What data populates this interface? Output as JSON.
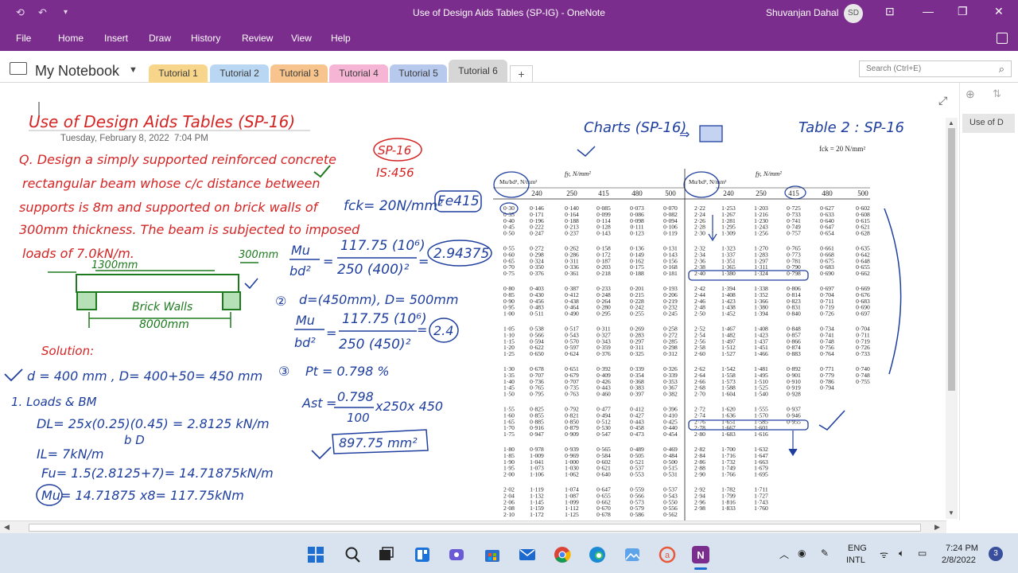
{
  "window": {
    "title": "Use of Design Aids Tables (SP-IG)  -  OneNote",
    "user_name": "Shuvanjan Dahal",
    "user_initials": "SD"
  },
  "menu": [
    "File",
    "Home",
    "Insert",
    "Draw",
    "History",
    "Review",
    "View",
    "Help"
  ],
  "notebook": {
    "name": "My Notebook",
    "tabs": [
      {
        "label": "Tutorial 1",
        "color": "#f7d58b"
      },
      {
        "label": "Tutorial 2",
        "color": "#b9d7f2"
      },
      {
        "label": "Tutorial 3",
        "color": "#f6c48c"
      },
      {
        "label": "Tutorial 4",
        "color": "#f6b5d5"
      },
      {
        "label": "Tutorial 5",
        "color": "#b8c9ee"
      },
      {
        "label": "Tutorial 6",
        "color": "#d6d6d6"
      }
    ],
    "add_tab": "+",
    "search_placeholder": "Search (Ctrl+E)"
  },
  "page_list": {
    "current": "Use of D"
  },
  "note": {
    "title": "Use of Design Aids Tables (SP-16)",
    "date": "Tuesday, February 8, 2022",
    "time": "7:04 PM",
    "question": [
      "Q. Design a simply supported reinforced concrete",
      "rectangular beam whose c/c distance between",
      "supports is 8m and supported on brick walls of",
      "300mm thickness. The beam is subjected to imposed",
      "loads of 7.0kN/m."
    ],
    "sketch": {
      "span": "1300mm",
      "support": "300mm",
      "walls": "Brick Walls",
      "length": "8000mm"
    },
    "solution_heading": "Solution:",
    "solution": [
      "d = 400 mm , D= 400+50= 450 mm",
      "1. Loads & BM",
      "DL= 25x(0.25)(0.45) = 2.8125 kN/m",
      "b        D",
      "IL= 7kN/m",
      "Fu= 1.5(2.8125+7)= 14.71875kN/m",
      "Mu= 14.71875 x8= 117.75kNm"
    ],
    "middle": {
      "sp16": "SP-16",
      "is456": "IS:456",
      "fck": "fck= 20N/mm²",
      "fe": "Fe415",
      "mu": "Mu",
      "bd2": "bd²",
      "eq1_num": "117.75 (10⁶)",
      "eq1_den": "250 (400)²",
      "eq1_res": "2.94375",
      "step2": "d=(450mm), D= 500mm",
      "eq2_num": "117.75 (10⁶)",
      "eq2_den": "250 (450)²",
      "eq2_res": "2.4",
      "step3": "Pt = 0.798 %",
      "ast": "Ast",
      "ast_num": "0.798",
      "ast_den": "100",
      "ast_tail": "x250x 450",
      "ast_res": "897.75 mm²"
    },
    "top_right": {
      "charts": "Charts (SP-16)",
      "table": "Table 2 : SP-16",
      "fck_note": "fck = 20 N/mm²"
    }
  },
  "table": {
    "fy_label": "fy, N/mm²",
    "mu_label": "Mu/bd², N/mm²",
    "fy_values": [
      "240",
      "250",
      "415",
      "480",
      "500"
    ],
    "left_groups": [
      [
        [
          "0·30",
          "0·146",
          "0·140",
          "0·085",
          "0·073",
          "0·070"
        ],
        [
          "0·35",
          "0·171",
          "0·164",
          "0·099",
          "0·086",
          "0·082"
        ],
        [
          "0·40",
          "0·196",
          "0·188",
          "0·114",
          "0·098",
          "0·094"
        ],
        [
          "0·45",
          "0·222",
          "0·213",
          "0·128",
          "0·111",
          "0·106"
        ],
        [
          "0·50",
          "0·247",
          "0·237",
          "0·143",
          "0·123",
          "0·119"
        ]
      ],
      [
        [
          "0·55",
          "0·272",
          "0·262",
          "0·158",
          "0·136",
          "0·131"
        ],
        [
          "0·60",
          "0·298",
          "0·286",
          "0·172",
          "0·149",
          "0·143"
        ],
        [
          "0·65",
          "0·324",
          "0·311",
          "0·187",
          "0·162",
          "0·156"
        ],
        [
          "0·70",
          "0·350",
          "0·336",
          "0·203",
          "0·175",
          "0·168"
        ],
        [
          "0·75",
          "0·376",
          "0·361",
          "0·218",
          "0·188",
          "0·181"
        ]
      ],
      [
        [
          "0·80",
          "0·403",
          "0·387",
          "0·233",
          "0·201",
          "0·193"
        ],
        [
          "0·85",
          "0·430",
          "0·412",
          "0·248",
          "0·215",
          "0·206"
        ],
        [
          "0·90",
          "0·456",
          "0·438",
          "0·264",
          "0·228",
          "0·219"
        ],
        [
          "0·95",
          "0·483",
          "0·464",
          "0·280",
          "0·242",
          "0·232"
        ],
        [
          "1·00",
          "0·511",
          "0·490",
          "0·295",
          "0·255",
          "0·245"
        ]
      ],
      [
        [
          "1·05",
          "0·538",
          "0·517",
          "0·311",
          "0·269",
          "0·258"
        ],
        [
          "1·10",
          "0·566",
          "0·543",
          "0·327",
          "0·283",
          "0·272"
        ],
        [
          "1·15",
          "0·594",
          "0·570",
          "0·343",
          "0·297",
          "0·285"
        ],
        [
          "1·20",
          "0·622",
          "0·597",
          "0·359",
          "0·311",
          "0·298"
        ],
        [
          "1·25",
          "0·650",
          "0·624",
          "0·376",
          "0·325",
          "0·312"
        ]
      ],
      [
        [
          "1·30",
          "0·678",
          "0·651",
          "0·392",
          "0·339",
          "0·326"
        ],
        [
          "1·35",
          "0·707",
          "0·679",
          "0·409",
          "0·354",
          "0·339"
        ],
        [
          "1·40",
          "0·736",
          "0·707",
          "0·426",
          "0·368",
          "0·353"
        ],
        [
          "1·45",
          "0·765",
          "0·735",
          "0·443",
          "0·383",
          "0·367"
        ],
        [
          "1·50",
          "0·795",
          "0·763",
          "0·460",
          "0·397",
          "0·382"
        ]
      ],
      [
        [
          "1·55",
          "0·825",
          "0·792",
          "0·477",
          "0·412",
          "0·396"
        ],
        [
          "1·60",
          "0·855",
          "0·821",
          "0·494",
          "0·427",
          "0·410"
        ],
        [
          "1·65",
          "0·885",
          "0·850",
          "0·512",
          "0·443",
          "0·425"
        ],
        [
          "1·70",
          "0·916",
          "0·879",
          "0·530",
          "0·458",
          "0·440"
        ],
        [
          "1·75",
          "0·947",
          "0·909",
          "0·547",
          "0·473",
          "0·454"
        ]
      ],
      [
        [
          "1·80",
          "0·978",
          "0·939",
          "0·565",
          "0·489",
          "0·469"
        ],
        [
          "1·85",
          "1·009",
          "0·969",
          "0·584",
          "0·505",
          "0·484"
        ],
        [
          "1·90",
          "1·041",
          "1·000",
          "0·602",
          "0·521",
          "0·500"
        ],
        [
          "1·95",
          "1·073",
          "1·030",
          "0·621",
          "0·537",
          "0·515"
        ],
        [
          "2·00",
          "1·106",
          "1·062",
          "0·640",
          "0·553",
          "0·531"
        ]
      ],
      [
        [
          "2·02",
          "1·119",
          "1·074",
          "0·647",
          "0·559",
          "0·537"
        ],
        [
          "2·04",
          "1·132",
          "1·087",
          "0·655",
          "0·566",
          "0·543"
        ],
        [
          "2·06",
          "1·145",
          "1·099",
          "0·662",
          "0·573",
          "0·550"
        ],
        [
          "2·08",
          "1·159",
          "1·112",
          "0·670",
          "0·579",
          "0·556"
        ],
        [
          "2·10",
          "1·172",
          "1·125",
          "0·678",
          "0·586",
          "0·562"
        ]
      ]
    ],
    "right_groups": [
      [
        [
          "2·22",
          "1·253",
          "1·203",
          "0·725",
          "0·627",
          "0·602"
        ],
        [
          "2·24",
          "1·267",
          "1·216",
          "0·733",
          "0·633",
          "0·608"
        ],
        [
          "2·26",
          "1·281",
          "1·230",
          "0·741",
          "0·640",
          "0·615"
        ],
        [
          "2·28",
          "1·295",
          "1·243",
          "0·749",
          "0·647",
          "0·621"
        ],
        [
          "2·30",
          "1·309",
          "1·256",
          "0·757",
          "0·654",
          "0·628"
        ]
      ],
      [
        [
          "2·32",
          "1·323",
          "1·270",
          "0·765",
          "0·661",
          "0·635"
        ],
        [
          "2·34",
          "1·337",
          "1·283",
          "0·773",
          "0·668",
          "0·642"
        ],
        [
          "2·36",
          "1·351",
          "1·297",
          "0·781",
          "0·675",
          "0·648"
        ],
        [
          "2·38",
          "1·365",
          "1·311",
          "0·790",
          "0·683",
          "0·655"
        ],
        [
          "2·40",
          "1·380",
          "1·324",
          "0·798",
          "0·690",
          "0·662"
        ]
      ],
      [
        [
          "2·42",
          "1·394",
          "1·338",
          "0·806",
          "0·697",
          "0·669"
        ],
        [
          "2·44",
          "1·408",
          "1·352",
          "0·814",
          "0·704",
          "0·676"
        ],
        [
          "2·46",
          "1·423",
          "1·366",
          "0·823",
          "0·711",
          "0·683"
        ],
        [
          "2·48",
          "1·438",
          "1·380",
          "0·831",
          "0·719",
          "0·690"
        ],
        [
          "2·50",
          "1·452",
          "1·394",
          "0·840",
          "0·726",
          "0·697"
        ]
      ],
      [
        [
          "2·52",
          "1·467",
          "1·408",
          "0·848",
          "0·734",
          "0·704"
        ],
        [
          "2·54",
          "1·482",
          "1·423",
          "0·857",
          "0·741",
          "0·711"
        ],
        [
          "2·56",
          "1·497",
          "1·437",
          "0·866",
          "0·748",
          "0·719"
        ],
        [
          "2·58",
          "1·512",
          "1·451",
          "0·874",
          "0·756",
          "0·726"
        ],
        [
          "2·60",
          "1·527",
          "1·466",
          "0·883",
          "0·764",
          "0·733"
        ]
      ],
      [
        [
          "2·62",
          "1·542",
          "1·481",
          "0·892",
          "0·771",
          "0·740"
        ],
        [
          "2·64",
          "1·558",
          "1·495",
          "0·901",
          "0·779",
          "0·748"
        ],
        [
          "2·66",
          "1·573",
          "1·510",
          "0·910",
          "0·786",
          "0·755"
        ],
        [
          "2·68",
          "1·588",
          "1·525",
          "0·919",
          "0·794",
          ""
        ],
        [
          "2·70",
          "1·604",
          "1·540",
          "0·928",
          "",
          ""
        ]
      ],
      [
        [
          "2·72",
          "1·620",
          "1·555",
          "0·937",
          "",
          ""
        ],
        [
          "2·74",
          "1·636",
          "1·570",
          "0·946",
          "",
          ""
        ],
        [
          "2·76",
          "1·651",
          "1·585",
          "0·955",
          "",
          ""
        ],
        [
          "2·78",
          "1·667",
          "1·601",
          "",
          "",
          ""
        ],
        [
          "2·80",
          "1·683",
          "1·616",
          "",
          "",
          ""
        ]
      ],
      [
        [
          "2·82",
          "1·700",
          "1·632",
          "",
          "",
          ""
        ],
        [
          "2·84",
          "1·716",
          "1·647",
          "",
          "",
          ""
        ],
        [
          "2·86",
          "1·732",
          "1·663",
          "",
          "",
          ""
        ],
        [
          "2·88",
          "1·749",
          "1·679",
          "",
          "",
          ""
        ],
        [
          "2·90",
          "1·766",
          "1·695",
          "",
          "",
          ""
        ]
      ],
      [
        [
          "2·92",
          "1·782",
          "1·711",
          "",
          "",
          ""
        ],
        [
          "2·94",
          "1·799",
          "1·727",
          "",
          "",
          ""
        ],
        [
          "2·96",
          "1·816",
          "1·743",
          "",
          "",
          ""
        ],
        [
          "2·98",
          "1·833",
          "1·760",
          "",
          "",
          ""
        ]
      ]
    ]
  },
  "taskbar": {
    "lang_top": "ENG",
    "lang_bottom": "INTL",
    "time": "7:24 PM",
    "date": "2/8/2022",
    "notifications": "3"
  }
}
